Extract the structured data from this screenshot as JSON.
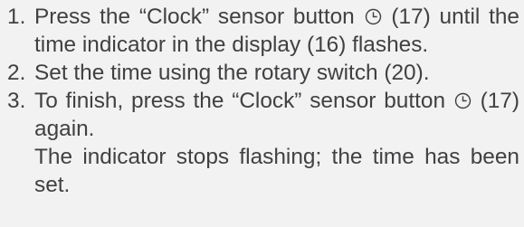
{
  "steps": [
    {
      "number": "1.",
      "before_icon": "Press the “Clock” sensor button ",
      "icon": "clock-icon",
      "after_icon": " (17) until the time indicator in the display (16) flashes."
    },
    {
      "number": "2.",
      "text": "Set the time using the rotary switch (20)."
    },
    {
      "number": "3.",
      "before_icon": "To finish, press the “Clock” sensor button ",
      "icon": "clock-icon",
      "after_icon": " (17) again."
    }
  ],
  "result_note": "The indicator stops flashing; the time has been set.",
  "colors": {
    "text": "#414042",
    "background": "#f2f2f2"
  }
}
